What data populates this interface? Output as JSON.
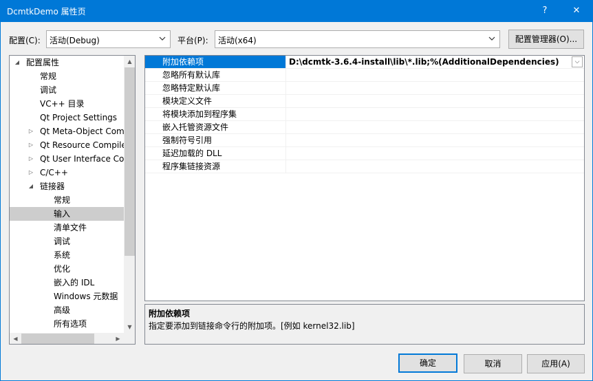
{
  "window": {
    "title": "DcmtkDemo 属性页",
    "help_glyph": "?",
    "close_glyph": "✕"
  },
  "toolbar": {
    "config_label": "配置(C):",
    "config_value": "活动(Debug)",
    "platform_label": "平台(P):",
    "platform_value": "活动(x64)",
    "config_manager_button": "配置管理器(O)..."
  },
  "tree": {
    "items": [
      {
        "label": "配置属性",
        "expander": "◢"
      },
      {
        "label": "常规",
        "expander": ""
      },
      {
        "label": "调试",
        "expander": ""
      },
      {
        "label": "VC++ 目录",
        "expander": ""
      },
      {
        "label": "Qt Project Settings",
        "expander": ""
      },
      {
        "label": "Qt Meta-Object Compiler",
        "expander": "▷"
      },
      {
        "label": "Qt Resource Compiler",
        "expander": "▷"
      },
      {
        "label": "Qt User Interface Compiler",
        "expander": "▷"
      },
      {
        "label": "C/C++",
        "expander": "▷"
      },
      {
        "label": "链接器",
        "expander": "◢"
      },
      {
        "label": "常规",
        "expander": ""
      },
      {
        "label": "输入",
        "expander": ""
      },
      {
        "label": "清单文件",
        "expander": ""
      },
      {
        "label": "调试",
        "expander": ""
      },
      {
        "label": "系统",
        "expander": ""
      },
      {
        "label": "优化",
        "expander": ""
      },
      {
        "label": "嵌入的 IDL",
        "expander": ""
      },
      {
        "label": "Windows 元数据",
        "expander": ""
      },
      {
        "label": "高级",
        "expander": ""
      },
      {
        "label": "所有选项",
        "expander": ""
      }
    ]
  },
  "properties": {
    "rows": [
      {
        "name": "附加依赖项",
        "value": "D:\\dcmtk-3.6.4-install\\lib\\*.lib;%(AdditionalDependencies)"
      },
      {
        "name": "忽略所有默认库",
        "value": ""
      },
      {
        "name": "忽略特定默认库",
        "value": ""
      },
      {
        "name": "模块定义文件",
        "value": ""
      },
      {
        "name": "将模块添加到程序集",
        "value": ""
      },
      {
        "name": "嵌入托管资源文件",
        "value": ""
      },
      {
        "name": "强制符号引用",
        "value": ""
      },
      {
        "name": "延迟加载的 DLL",
        "value": ""
      },
      {
        "name": "程序集链接资源",
        "value": ""
      }
    ],
    "selected_index": 0
  },
  "description": {
    "title": "附加依赖项",
    "text": "指定要添加到链接命令行的附加项。[例如 kernel32.lib]"
  },
  "buttons": {
    "ok": "确定",
    "cancel": "取消",
    "apply": "应用(A)"
  },
  "colors": {
    "accent": "#0078d7",
    "selection_gray": "#cdcdcd"
  }
}
